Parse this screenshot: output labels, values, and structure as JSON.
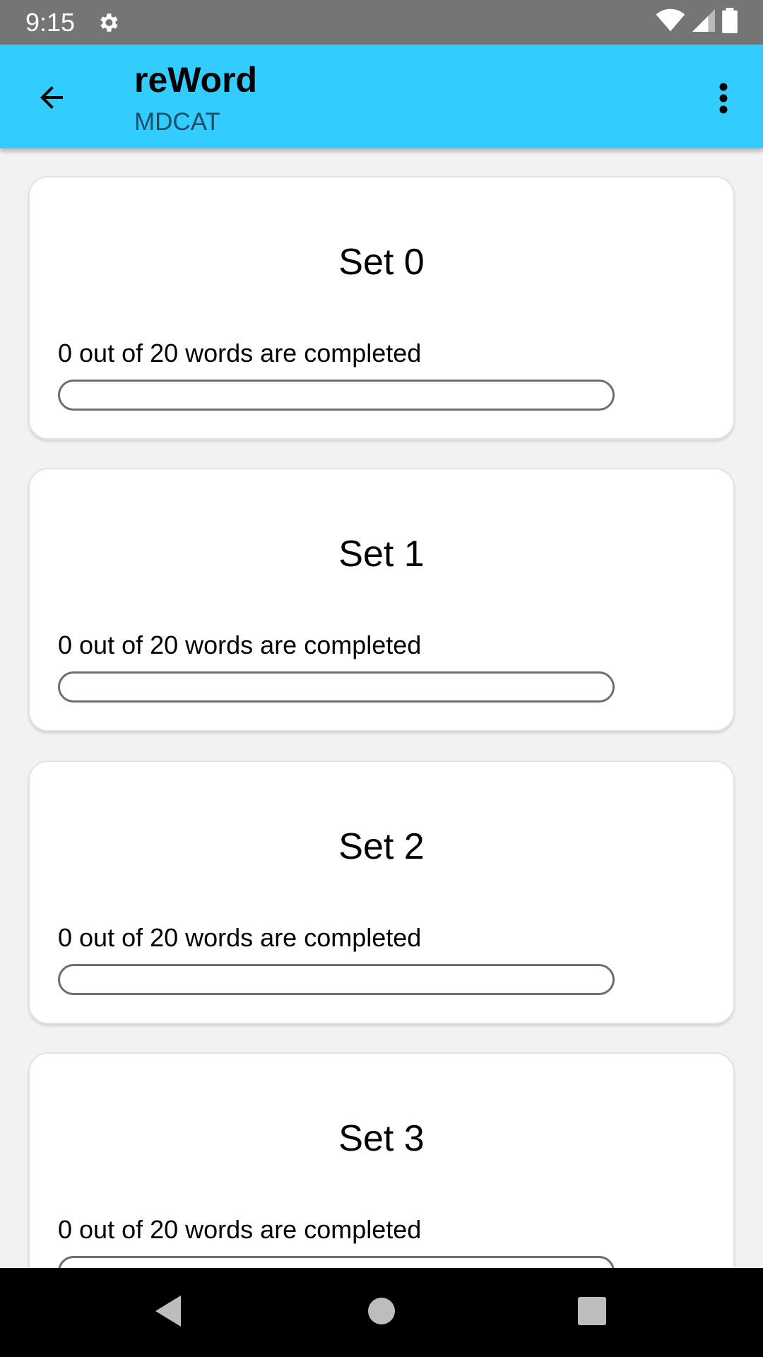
{
  "status_bar": {
    "time": "9:15",
    "icons": [
      "gear-icon",
      "wifi-icon",
      "signal-icon",
      "battery-icon"
    ]
  },
  "app_bar": {
    "title": "reWord",
    "subtitle": "MDCAT",
    "back_icon": "arrow-left-icon",
    "overflow_icon": "more-vert-icon",
    "background": "#33ccff"
  },
  "sets": [
    {
      "title": "Set 0",
      "progress_text": "0 out of 20 words are completed",
      "progress": 0
    },
    {
      "title": "Set 1",
      "progress_text": "0 out of 20 words are completed",
      "progress": 0
    },
    {
      "title": "Set 2",
      "progress_text": "0 out of 20 words are completed",
      "progress": 0
    },
    {
      "title": "Set 3",
      "progress_text": "0 out of 20 words are completed",
      "progress": 0
    }
  ],
  "nav_bar": {
    "icons": [
      "back-triangle-icon",
      "home-circle-icon",
      "recents-square-icon"
    ]
  }
}
